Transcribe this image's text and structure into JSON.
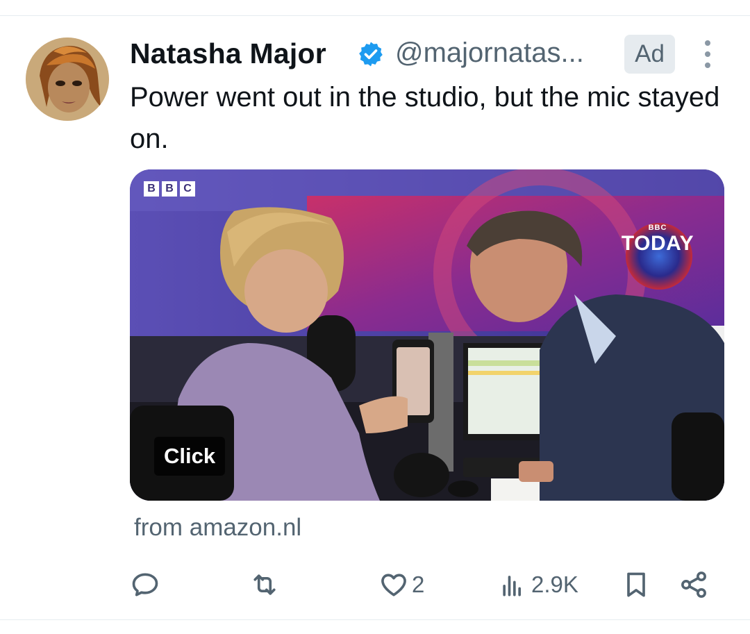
{
  "tweet": {
    "author_name": "Natasha Major",
    "handle": "@majornatas...",
    "ad_label": "Ad",
    "text": "Power went out in the studio, but the mic stayed on.",
    "source": "from amazon.nl"
  },
  "media": {
    "logo_letters": [
      "B",
      "B",
      "C"
    ],
    "today_brand": "BBC",
    "today_label": "TODAY",
    "cta_label": "Click"
  },
  "actions": {
    "reply": {
      "icon": "reply-icon",
      "count": ""
    },
    "repost": {
      "icon": "repost-icon",
      "count": ""
    },
    "like": {
      "icon": "heart-icon",
      "count": "2"
    },
    "views": {
      "icon": "views-icon",
      "count": "2.9K"
    },
    "bookmark": {
      "icon": "bookmark-icon",
      "count": ""
    },
    "share": {
      "icon": "share-icon",
      "count": ""
    }
  },
  "colors": {
    "verified": "#1d9bf0",
    "secondary_text": "#536471",
    "primary_text": "#0f1419"
  }
}
